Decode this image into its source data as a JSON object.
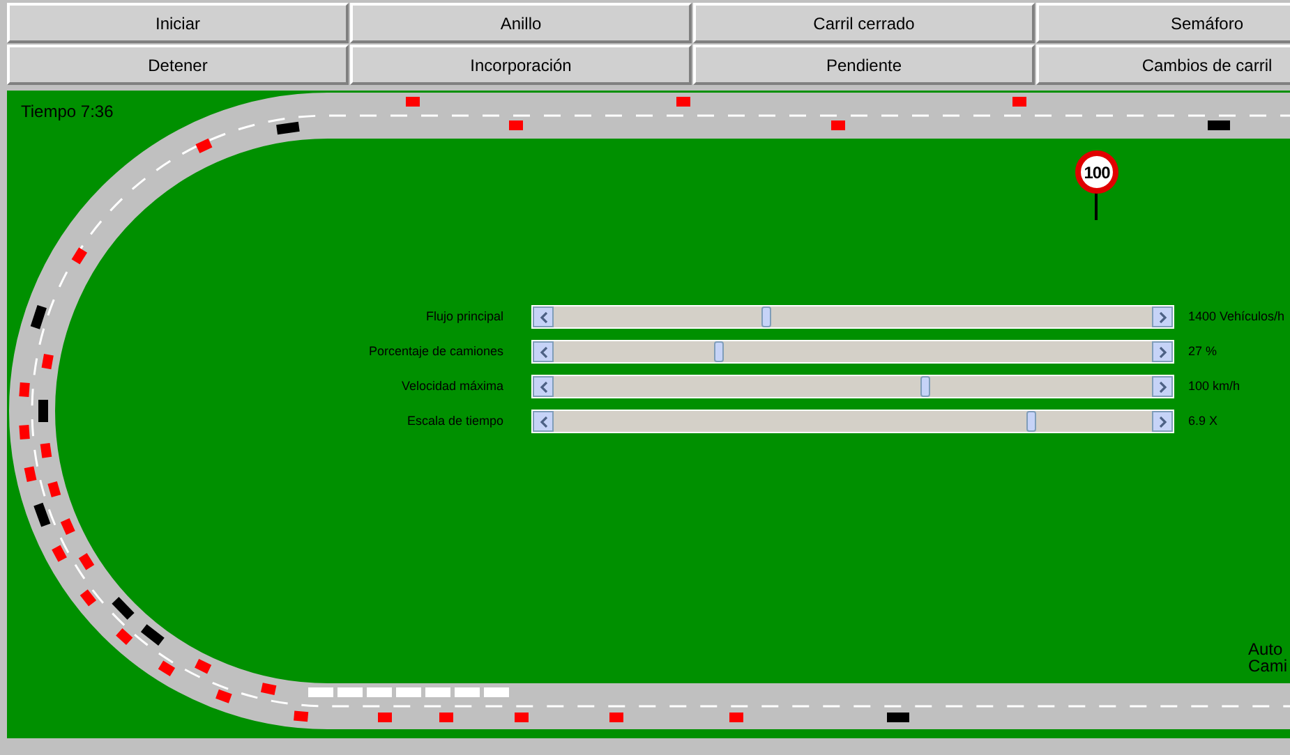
{
  "buttons": [
    {
      "label": "Iniciar"
    },
    {
      "label": "Anillo"
    },
    {
      "label": "Carril cerrado"
    },
    {
      "label": "Semáforo"
    },
    {
      "label": "Detener"
    },
    {
      "label": "Incorporación"
    },
    {
      "label": "Pendiente"
    },
    {
      "label": "Cambios de carril"
    }
  ],
  "simulation": {
    "time": "Tiempo 7:36",
    "speed_sign": "100",
    "sliders": [
      {
        "label": "Flujo principal",
        "level": 0.35,
        "reading": "1400 Vehículos/h"
      },
      {
        "label": "Porcentaje de camiones",
        "level": 0.27,
        "reading": "27 %"
      },
      {
        "label": "Velocidad máxima",
        "level": 0.62,
        "reading": "100 km/h"
      },
      {
        "label": "Escala de tiempo",
        "level": 0.8,
        "reading": "6.9 X"
      }
    ],
    "legend": [
      "Auto",
      "Cami"
    ]
  }
}
